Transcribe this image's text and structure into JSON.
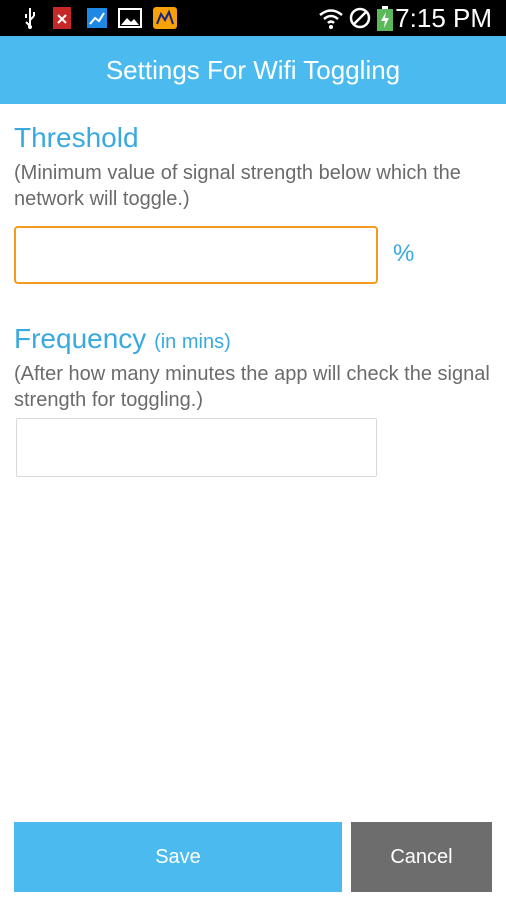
{
  "status_bar": {
    "time": "7:15 PM",
    "icons": [
      "usb-icon",
      "error-app-icon",
      "chart-app-icon",
      "gallery-icon",
      "app-icon",
      "wifi-icon",
      "no-sim-icon",
      "battery-charging-icon"
    ]
  },
  "header": {
    "title": "Settings For Wifi Toggling"
  },
  "threshold": {
    "title": "Threshold",
    "hint": "(Minimum value of signal strength below which the network will toggle.)",
    "value": "",
    "unit": "%"
  },
  "frequency": {
    "title": "Frequency",
    "subtitle": "(in mins)",
    "hint": "(After how many minutes the app will check the signal strength for toggling.)",
    "value": ""
  },
  "buttons": {
    "save": "Save",
    "cancel": "Cancel"
  },
  "colors": {
    "accent": "#4bbbef",
    "heading": "#39a9e0",
    "focus": "#f39a1f",
    "cancel": "#6d6d6d"
  }
}
